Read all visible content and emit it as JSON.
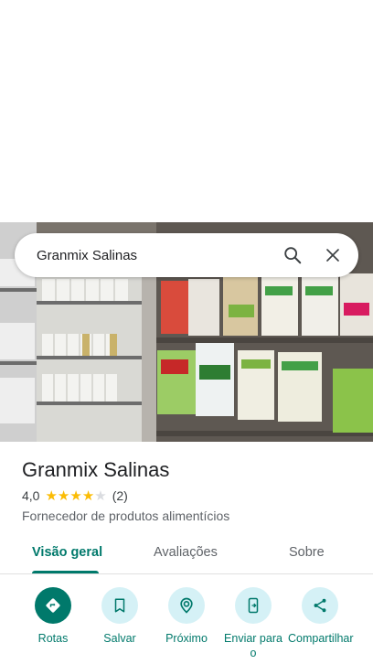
{
  "search": {
    "query": "Granmix Salinas"
  },
  "place": {
    "name": "Granmix Salinas",
    "rating": "4,0",
    "stars_filled": 4,
    "stars_total": 5,
    "review_count": "(2)",
    "category": "Fornecedor de produtos alimentícios"
  },
  "tabs": [
    {
      "label": "Visão geral",
      "active": true
    },
    {
      "label": "Avaliações",
      "active": false
    },
    {
      "label": "Sobre",
      "active": false
    }
  ],
  "actions": [
    {
      "label": "Rotas",
      "icon": "directions-icon"
    },
    {
      "label": "Salvar",
      "icon": "bookmark-icon"
    },
    {
      "label": "Próximo",
      "icon": "nearby-icon"
    },
    {
      "label": "Enviar para o",
      "icon": "send-to-phone-icon"
    },
    {
      "label": "Compartilhar",
      "icon": "share-icon"
    }
  ],
  "colors": {
    "accent": "#00796b",
    "chip": "#d5f1f6",
    "star": "#fbbc04"
  }
}
